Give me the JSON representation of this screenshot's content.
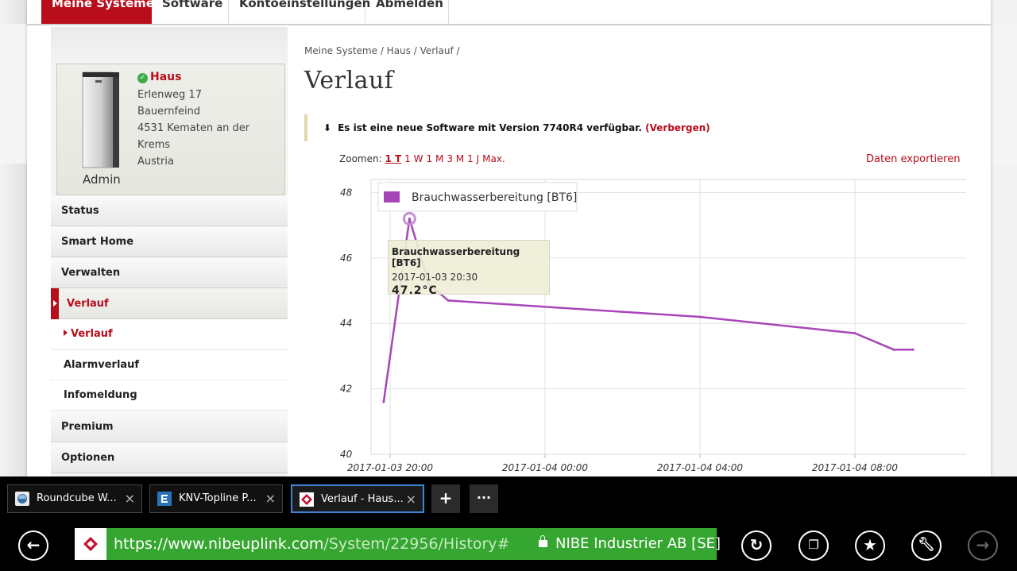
{
  "nav": {
    "tabs": [
      {
        "label": "Meine Systeme",
        "active": true
      },
      {
        "label": "Software"
      },
      {
        "label": "Kontoeinstellungen"
      },
      {
        "label": "Abmelden"
      }
    ]
  },
  "system": {
    "name": "Haus",
    "address": [
      "Erlenweg 17",
      "Bauernfeind",
      "4531 Kematen an der Krems",
      "Austria"
    ],
    "role": "Admin"
  },
  "sidebar": {
    "items": [
      "Status",
      "Smart Home",
      "Verwalten",
      "Verlauf"
    ],
    "subitems": [
      "Verlauf",
      "Alarmverlauf",
      "Infomeldung"
    ],
    "items2": [
      "Premium",
      "Optionen"
    ]
  },
  "main": {
    "breadcrumb": "Meine Systeme / Haus / Verlauf /",
    "title": "Verlauf",
    "notice": "Es ist eine neue Software mit Version 7740R4 verfügbar.",
    "notice_link": "(Verbergen)",
    "zoom_label": "Zoomen:",
    "zoom_options": [
      "1 T",
      "1 W",
      "1 M",
      "3 M",
      "1 J",
      "Max."
    ],
    "export_label": "Daten exportieren"
  },
  "chart_data": {
    "type": "line",
    "series": [
      {
        "name": "Brauchwasserbereitung [BT6]",
        "color": "#a646b8",
        "points": [
          [
            "2017-01-03 19:50",
            41.6
          ],
          [
            "2017-01-03 20:30",
            47.2
          ],
          [
            "2017-01-03 21:00",
            45.2
          ],
          [
            "2017-01-03 21:30",
            44.7
          ],
          [
            "2017-01-04 04:00",
            44.2
          ],
          [
            "2017-01-04 08:00",
            43.7
          ],
          [
            "2017-01-04 09:00",
            43.2
          ],
          [
            "2017-01-04 09:30",
            43.2
          ]
        ]
      }
    ],
    "x_ticks": [
      "2017-01-03 20:00",
      "2017-01-04 00:00",
      "2017-01-04 04:00",
      "2017-01-04 08:00"
    ],
    "y_ticks": [
      40,
      42,
      44,
      46,
      48
    ],
    "ylim": [
      40,
      48.4
    ],
    "grid": true,
    "legend": "top-left",
    "tooltip": {
      "series": "Brauchwasserbereitung [BT6]",
      "time": "2017-01-03 20:30",
      "value": "47.2°C"
    }
  },
  "browser": {
    "tabs": [
      {
        "label": "Roundcube W...",
        "active": false
      },
      {
        "label": "KNV-Topline P...",
        "active": false
      },
      {
        "label": "Verlauf - Haus...",
        "active": true
      }
    ],
    "new_tab": "+",
    "more": "···",
    "url_host": "https://www.nibeuplink.com",
    "url_path": "/System/22956/History#",
    "cert": "NIBE Industrier AB [SE]",
    "colors": {
      "url_bar": "#35a62f",
      "active_tab": "#3e85d8"
    }
  },
  "brand": {
    "accent": "#b80d1b"
  }
}
